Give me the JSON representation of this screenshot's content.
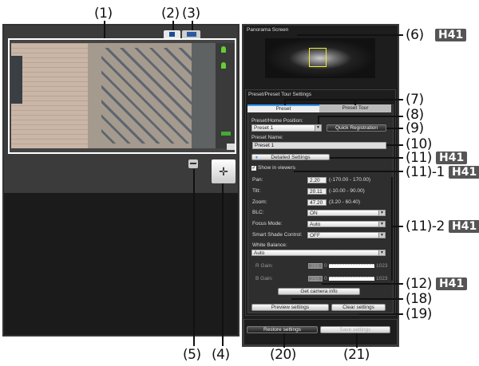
{
  "callouts": {
    "c1": "(1)",
    "c2": "(2)",
    "c3": "(3)",
    "c4": "(4)",
    "c5": "(5)",
    "c6": "(6)",
    "c7": "(7)",
    "c8": "(8)",
    "c9": "(9)",
    "c10": "(10)",
    "c11": "(11)",
    "c11_1": "(11)-1",
    "c11_2": "(11)-2",
    "c12": "(12)",
    "c18": "(18)",
    "c19": "(19)",
    "c20": "(20)",
    "c21": "(21)",
    "badge": "H41"
  },
  "panorama": {
    "title": "Panorama Screen"
  },
  "preset": {
    "section_title": "Preset/Preset Tour Settings",
    "tabs": [
      {
        "label": "Preset",
        "active": true
      },
      {
        "label": "Preset Tour",
        "active": false
      }
    ],
    "home_position_label": "Preset/Home Position:",
    "home_position_value": "Preset 1",
    "quick_registration": "Quick Registration",
    "preset_name_label": "Preset Name:",
    "preset_name_value": "Preset 1",
    "detailed_settings": "Detailed Settings",
    "show_in_viewers": "Show in viewers",
    "show_in_viewers_checked": true,
    "pan": {
      "label": "Pan:",
      "value": "2.20",
      "range": "(-170.00 - 170.00)"
    },
    "tilt": {
      "label": "Tilt:",
      "value": "20.11",
      "range": "(-10.00 - 90.00)"
    },
    "zoom": {
      "label": "Zoom:",
      "value": "47.20",
      "range": "(3.20 - 60.40)"
    },
    "blc": {
      "label": "BLC:",
      "value": "ON"
    },
    "focus": {
      "label": "Focus Mode:",
      "value": "Auto"
    },
    "smart_shade": {
      "label": "Smart Shade Control:",
      "value": "OFF"
    },
    "white_balance": {
      "label": "White Balance:",
      "value": "Auto"
    },
    "r_gain": {
      "label": "R Gain:",
      "value": "255",
      "min": "0",
      "max": "1023"
    },
    "b_gain": {
      "label": "B Gain:",
      "value": "255",
      "min": "0",
      "max": "1023"
    },
    "get_camera_info": "Get camera info",
    "preview_settings": "Preview settings",
    "clear_settings": "Clear settings"
  },
  "footer": {
    "restore": "Restore settings",
    "save": "Save settings"
  }
}
